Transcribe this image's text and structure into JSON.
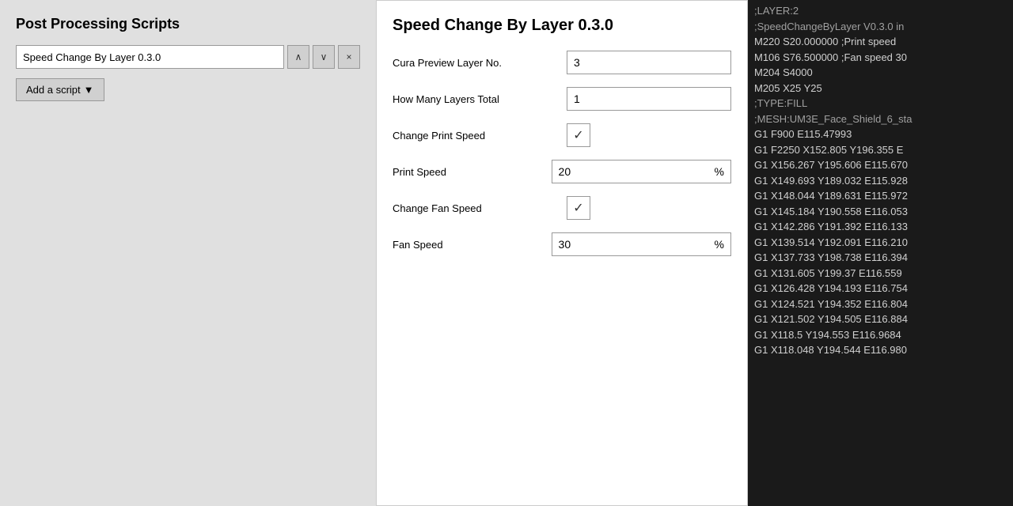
{
  "leftPanel": {
    "title": "Post Processing Scripts",
    "scriptName": "Speed Change By Layer 0.3.0",
    "addScriptLabel": "Add a script",
    "addScriptDropdownIcon": "▼",
    "upIcon": "∧",
    "downIcon": "∨",
    "closeIcon": "×"
  },
  "middlePanel": {
    "scriptTitle": "Speed Change By Layer 0.3.0",
    "fields": [
      {
        "label": "Cura Preview Layer No.",
        "type": "text",
        "value": "3",
        "unit": null
      },
      {
        "label": "How Many Layers Total",
        "type": "text",
        "value": "1",
        "unit": null
      },
      {
        "label": "Change Print Speed",
        "type": "checkbox",
        "checked": true,
        "unit": null
      },
      {
        "label": "Print Speed",
        "type": "number",
        "value": "20",
        "unit": "%"
      },
      {
        "label": "Change Fan Speed",
        "type": "checkbox",
        "checked": true,
        "unit": null
      },
      {
        "label": "Fan Speed",
        "type": "number",
        "value": "30",
        "unit": "%"
      }
    ]
  },
  "rightPanel": {
    "lines": [
      ";LAYER:2",
      ";SpeedChangeByLayer V0.3.0 in",
      "M220 S20.000000 ;Print speed",
      "M106 S76.500000 ;Fan speed 30",
      "M204 S4000",
      "M205 X25 Y25",
      ";TYPE:FILL",
      ";MESH:UM3E_Face_Shield_6_sta",
      "G1 F900 E115.47993",
      "G1 F2250 X152.805 Y196.355 E",
      "G1 X156.267 Y195.606 E115.670",
      "G1 X149.693 Y189.032 E115.928",
      "G1 X148.044 Y189.631 E115.972",
      "G1 X145.184 Y190.558 E116.053",
      "G1 X142.286 Y191.392 E116.133",
      "G1 X139.514 Y192.091 E116.210",
      "G1 X137.733 Y198.738 E116.394",
      "G1 X131.605 Y199.37 E116.559",
      "G1 X126.428 Y194.193 E116.754",
      "G1 X124.521 Y194.352 E116.804",
      "G1 X121.502 Y194.505 E116.884",
      "G1 X118.5 Y194.553 E116.9684",
      "G1 X118.048 Y194.544 E116.980"
    ]
  }
}
